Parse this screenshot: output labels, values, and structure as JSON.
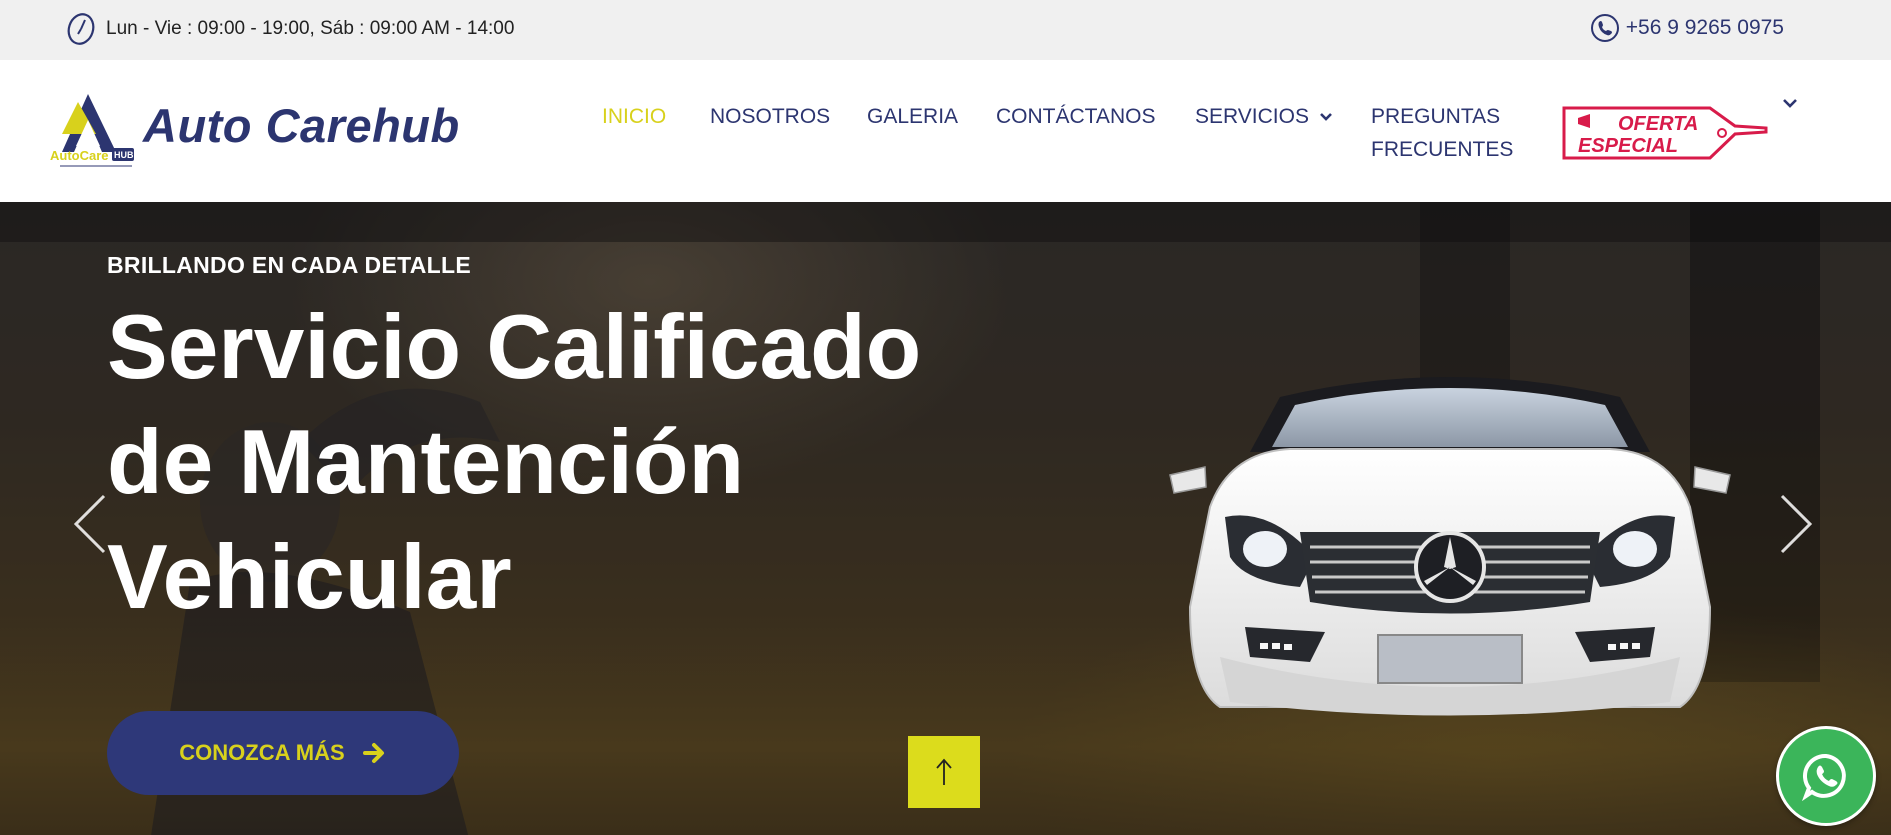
{
  "topbar": {
    "hours": "Lun - Vie : 09:00 - 19:00, Sáb : 09:00 AM - 14:00",
    "phone": "+56 9 9265 0975",
    "clock_icon": "clock-icon",
    "phone_icon": "phone-icon"
  },
  "header": {
    "logo_text": "AutoCare",
    "logo_hub": "HUB",
    "brand": "Auto Carehub",
    "nav": [
      {
        "label": "INICIO",
        "active": true
      },
      {
        "label": "NOSOTROS"
      },
      {
        "label": "GALERIA"
      },
      {
        "label": "CONTÁCTANOS"
      },
      {
        "label": "SERVICIOS",
        "has_dropdown": true
      },
      {
        "label": "PREGUNTAS FRECUENTES"
      }
    ],
    "offer_tag": {
      "line1": "OFERTA",
      "line2": "ESPECIAL"
    }
  },
  "hero": {
    "eyebrow": "BRILLANDO EN CADA DETALLE",
    "headline": "Servicio Calificado de Mantención Vehicular",
    "cta_label": "CONOZCA MÁS"
  },
  "colors": {
    "brand_navy": "#2c3570",
    "accent_yellow": "#d8d11c",
    "whatsapp_green": "#3bb55a",
    "offer_red": "#d81b4a"
  }
}
